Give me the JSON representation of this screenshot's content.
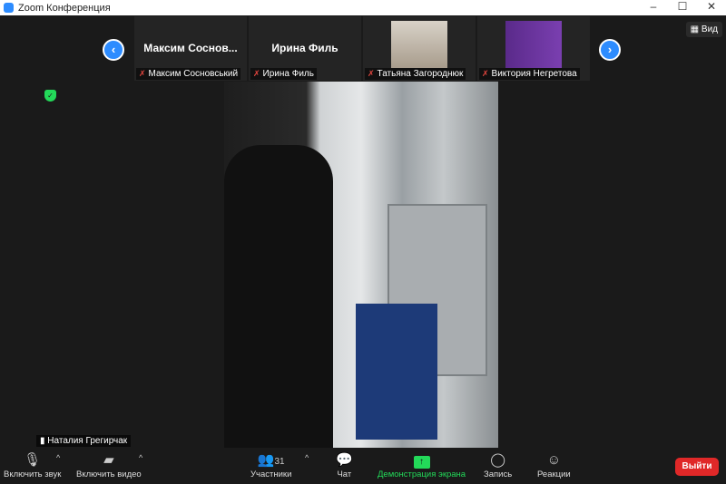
{
  "window": {
    "title": "Zoom Конференция",
    "minimize": "–",
    "maximize": "☐",
    "close": "✕"
  },
  "view_button": "Вид",
  "participants_strip": [
    {
      "big_name": "Максим  Соснов...",
      "label": "Максим Сосновський"
    },
    {
      "big_name": "Ирина Филь",
      "label": "Ирина Филь"
    },
    {
      "big_name": "",
      "label": "Татьяна Загороднюк"
    },
    {
      "big_name": "",
      "label": "Виктория Негретова"
    }
  ],
  "nav": {
    "prev": "‹",
    "next": "›"
  },
  "active_speaker": "Наталия Грегирчак",
  "toolbar": {
    "unmute": "Включить звук",
    "start_video": "Включить видео",
    "participants": "Участники",
    "participants_count": "31",
    "chat": "Чат",
    "share": "Демонстрация экрана",
    "record": "Запись",
    "reactions": "Реакции",
    "leave": "Выйти"
  }
}
